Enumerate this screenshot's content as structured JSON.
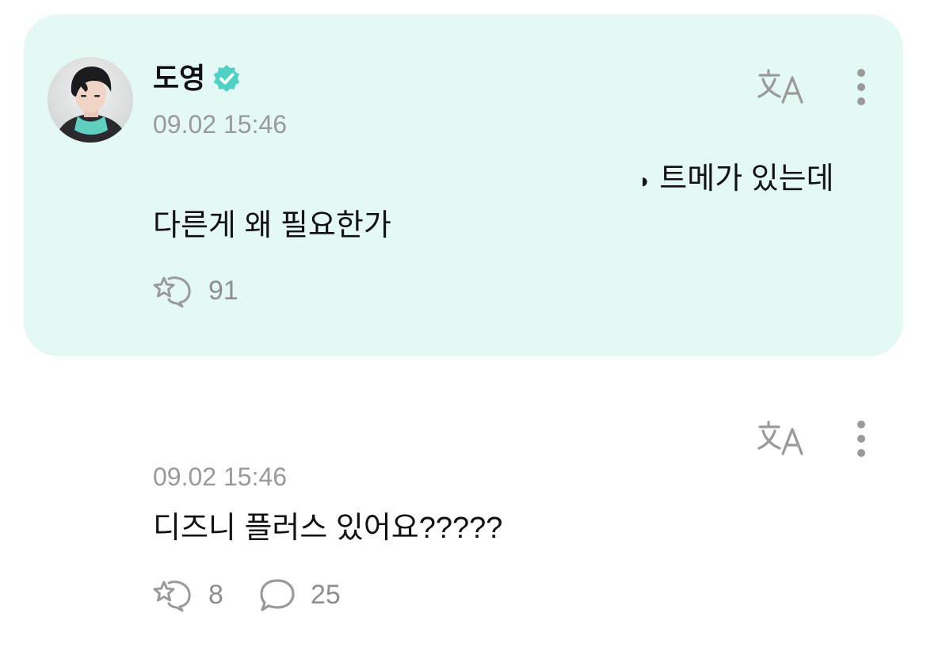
{
  "colors": {
    "card_background": "#e4f8f6",
    "verified_badge": "#4fd1c5",
    "icon_gray": "#9a9a9a",
    "text_primary": "#111111",
    "text_secondary": "#9a9a9a"
  },
  "post": {
    "author": "도영",
    "verified": true,
    "verified_icon": "verified-badge-icon",
    "timestamp": "09.02 15:46",
    "message_line1": "트메가 있는데",
    "message_line1_prefix": "◗",
    "message_line2": "다른게 왜 필요한가",
    "reaction_icon": "reaction-star-icon",
    "reaction_count": "91",
    "translate_icon": "translate-icon",
    "more_icon": "more-vertical-icon"
  },
  "reply": {
    "timestamp": "09.02 15:46",
    "message": "디즈니 플러스 있어요?????",
    "reaction_icon": "reaction-star-icon",
    "reaction_count": "8",
    "comment_icon": "comment-bubble-icon",
    "comment_count": "25",
    "translate_icon": "translate-icon",
    "more_icon": "more-vertical-icon"
  }
}
